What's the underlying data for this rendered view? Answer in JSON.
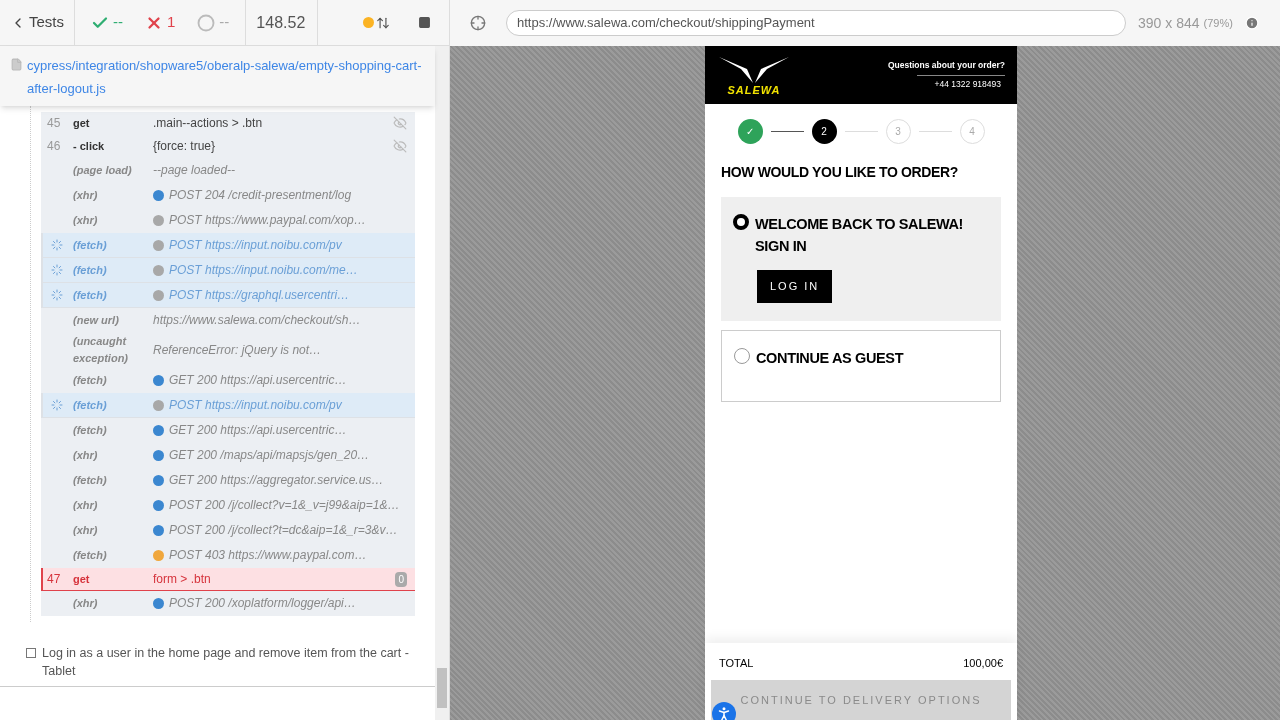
{
  "runner": {
    "back_label": "Tests",
    "passed": "--",
    "failed": "1",
    "pending": "--",
    "duration": "148.52",
    "spec_path": "cypress/integration/shopware5/oberalp-salewa/empty-shopping-cart-after-logout.js"
  },
  "log": [
    {
      "kind": "command",
      "number": "45",
      "name": "get",
      "message": ".main--actions > .btn",
      "hidden": true,
      "pending": false,
      "failed": false
    },
    {
      "kind": "command",
      "number": "46",
      "name": "- click",
      "message": "{force: true}",
      "hidden": true,
      "pending": false,
      "failed": false
    },
    {
      "kind": "event",
      "name": "(page load)",
      "message": "--page loaded--",
      "pending": false,
      "failed": false
    },
    {
      "kind": "event",
      "name": "(xhr)",
      "message": "POST 204 /credit-presentment/log",
      "color": "#3b87d0",
      "pending": false,
      "failed": false
    },
    {
      "kind": "event",
      "name": "(xhr)",
      "message": "POST https://www.paypal.com/xop…",
      "color": "#a8a8a8",
      "pending": false,
      "failed": false
    },
    {
      "kind": "event",
      "name": "(fetch)",
      "message": "POST https://input.noibu.com/pv",
      "color": "#a8a8a8",
      "pending": true,
      "failed": false
    },
    {
      "kind": "event",
      "name": "(fetch)",
      "message": "POST https://input.noibu.com/me…",
      "color": "#a8a8a8",
      "pending": true,
      "failed": false
    },
    {
      "kind": "event",
      "name": "(fetch)",
      "message": "POST https://graphql.usercentri…",
      "color": "#a8a8a8",
      "pending": true,
      "failed": false
    },
    {
      "kind": "event",
      "name": "(new url)",
      "message": "https://www.salewa.com/checkout/sh…",
      "pending": false,
      "failed": false
    },
    {
      "kind": "event",
      "name": "(uncaught exception)",
      "message": "ReferenceError: jQuery is not…",
      "pending": false,
      "failed": false
    },
    {
      "kind": "event",
      "name": "(fetch)",
      "message": "GET 200 https://api.usercentric…",
      "color": "#3b87d0",
      "pending": false,
      "failed": false
    },
    {
      "kind": "event",
      "name": "(fetch)",
      "message": "POST https://input.noibu.com/pv",
      "color": "#a8a8a8",
      "pending": true,
      "failed": false
    },
    {
      "kind": "event",
      "name": "(fetch)",
      "message": "GET 200 https://api.usercentric…",
      "color": "#3b87d0",
      "pending": false,
      "failed": false
    },
    {
      "kind": "event",
      "name": "(xhr)",
      "message": "GET 200 /maps/api/mapsjs/gen_20…",
      "color": "#3b87d0",
      "pending": false,
      "failed": false
    },
    {
      "kind": "event",
      "name": "(fetch)",
      "message": "GET 200 https://aggregator.service.us…",
      "color": "#3b87d0",
      "pending": false,
      "failed": false
    },
    {
      "kind": "event",
      "name": "(xhr)",
      "message": "POST 200 /j/collect?v=1&_v=j99&aip=1&…",
      "color": "#3b87d0",
      "pending": false,
      "failed": false
    },
    {
      "kind": "event",
      "name": "(xhr)",
      "message": "POST 200 /j/collect?t=dc&aip=1&_r=3&v…",
      "color": "#3b87d0",
      "pending": false,
      "failed": false
    },
    {
      "kind": "event",
      "name": "(fetch)",
      "message": "POST 403 https://www.paypal.com…",
      "color": "#f0a73c",
      "pending": false,
      "failed": false
    },
    {
      "kind": "command",
      "number": "47",
      "name": "get",
      "message": "form > .btn",
      "count": "0",
      "hidden": false,
      "pending": false,
      "failed": true
    },
    {
      "kind": "event",
      "name": "(xhr)",
      "message": "POST 200 /xoplatform/logger/api…",
      "color": "#3b87d0",
      "pending": false,
      "failed": false
    }
  ],
  "next_test": {
    "title": "Log in as a user in the home page and remove item from the cart - Tablet",
    "checked": false
  },
  "browser": {
    "url": "https://www.salewa.com/checkout/shippingPayment",
    "size": "390 x 844",
    "scale": "(79%)"
  },
  "site": {
    "logo_text": "SALEWA",
    "help_title": "Questions about your order?",
    "phone": "+44 1322 918493",
    "steps": [
      {
        "label": "✓",
        "done": true,
        "selected": false
      },
      {
        "label": "2",
        "done": false,
        "selected": true
      },
      {
        "label": "3",
        "done": false,
        "selected": false
      },
      {
        "label": "4",
        "done": false,
        "selected": false
      }
    ],
    "heading": "HOW WOULD YOU LIKE TO ORDER?",
    "options": [
      {
        "title": "WELCOME BACK TO SALEWA! SIGN IN",
        "button": "LOG IN",
        "selected": true
      },
      {
        "title": "CONTINUE AS GUEST",
        "selected": false
      }
    ],
    "total_label": "TOTAL",
    "total": "100,00€",
    "continue_button": "CONTINUE TO DELIVERY OPTIONS",
    "continue_disabled": true
  }
}
